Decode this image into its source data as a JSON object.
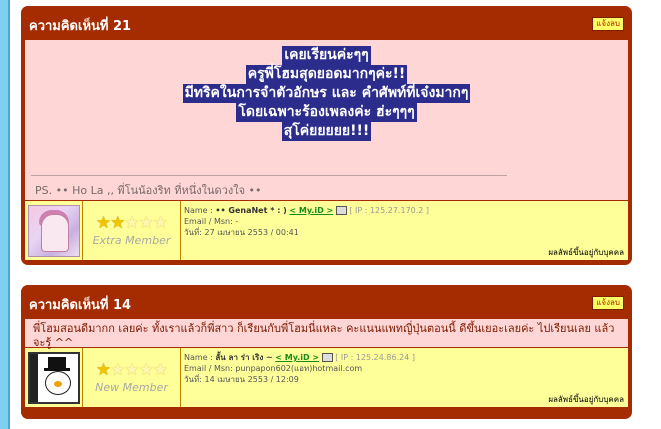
{
  "comments": [
    {
      "title": "ความคิดเห็นที่ 21",
      "report_label": "แจ้งลบ",
      "highlight_lines": [
        "เคยเรียนค่ะๆๆ",
        "ครูพี่โฮมสุดยอดมากๆค่ะ!!",
        "มีทริคในการจำตัวอักษร และ คำศัพท์ที่เจ๋งมากๆ",
        "โดยเฉพาะร้องเพลงค่ะ ฮ่ะๆๆๆ",
        "สุโค่ยยยยย!!!"
      ],
      "signature": "PS.  •• Ho La ,, พี่โนน้องริท ที่หนึ่งในดวงใจ ••",
      "rank_label": "Extra Member",
      "stars_filled": 2,
      "stars_total": 5,
      "name_prefix": "Name : ",
      "name": "•• GenaNet * : )",
      "myid": "< My.iD >",
      "ip": "[ IP : 125.27.170.2 ]",
      "email": "Email / Msn:  -",
      "date": "วันที่: 27 เมษายน 2553 / 00:41",
      "footer": "ผลลัพธ์ขึ้นอยู่กับบุคคล"
    },
    {
      "title": "ความคิดเห็นที่ 14",
      "report_label": "แจ้งลบ",
      "body": "พี่โฮมสอนดีมากก เลยค่ะ ทั้งเราแล้วก็พี่สาว ก็เรียนกับพี่โฮมนี่แหละ คะแนนแพทญี่ปุ่นตอนนี้ ดีขึ้นเยอะเลยค่ะ ไปเรียนเลย แล้วจะรู้ ^^",
      "rank_label": "New Member",
      "stars_filled": 1,
      "stars_total": 5,
      "name_prefix": "Name : ",
      "name": "ลั้น ลา ร่า เริง ~",
      "myid": "< My.iD >",
      "ip": "[ IP : 125.24.86.24 ]",
      "email": "Email / Msn:  punpapon602(แอท)hotmail.com",
      "date": "วันที่: 14 เมษายน 2553 / 12:09",
      "footer": "ผลลัพธ์ขึ้นอยู่กับบุคคล"
    }
  ],
  "colors": {
    "frame": "#a52c00",
    "content_bg": "#ffd6d6",
    "info_bg": "#ffff99",
    "highlight_bg": "#2c2c8c"
  }
}
